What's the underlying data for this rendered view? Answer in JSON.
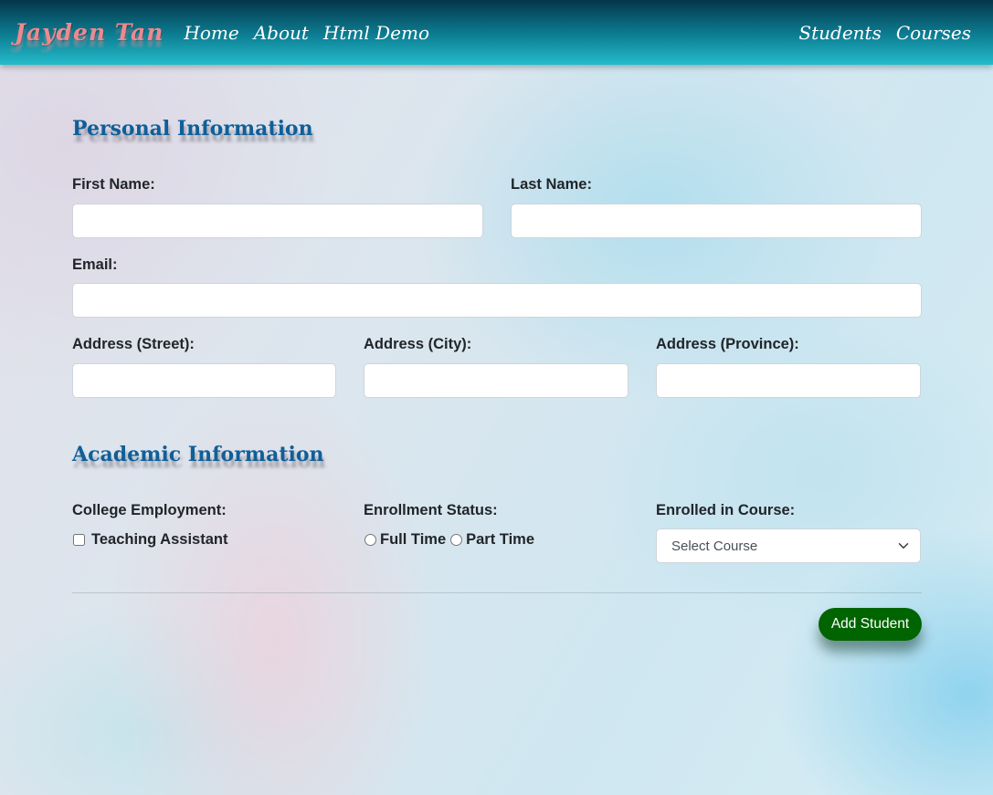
{
  "navbar": {
    "brand": "Jayden Tan",
    "left_links": [
      "Home",
      "About",
      "Html Demo"
    ],
    "right_links": [
      "Students",
      "Courses"
    ]
  },
  "personal": {
    "title": "Personal Information",
    "first_name_label": "First Name:",
    "last_name_label": "Last Name:",
    "email_label": "Email:",
    "street_label": "Address (Street):",
    "city_label": "Address (City):",
    "province_label": "Address (Province):"
  },
  "academic": {
    "title": "Academic Information",
    "employment_label": "College Employment:",
    "ta_label": "Teaching Assistant",
    "enrollment_label": "Enrollment Status:",
    "full_time_label": "Full Time",
    "part_time_label": "Part Time",
    "course_label": "Enrolled in Course:",
    "course_selected": "Select Course"
  },
  "actions": {
    "add_student": "Add Student"
  },
  "colors": {
    "navbar_dark": "#04364a",
    "navbar_light": "#24bccb",
    "brand": "#ec8a8f",
    "section_title": "#0f5f99",
    "add_button": "#006400"
  },
  "icons": {
    "select_caret": "chevron-down-icon"
  }
}
